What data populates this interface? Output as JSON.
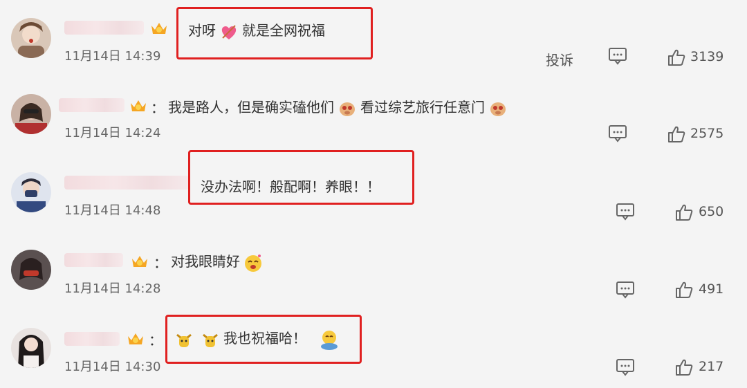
{
  "comments": [
    {
      "text": "对呀",
      "text2": "就是全网祝福",
      "time": "11月14日 14:39",
      "report": "投诉",
      "likes": "3139"
    },
    {
      "text": "我是路人，但是确实磕他们",
      "text2": "看过综艺旅行任意门",
      "time": "11月14日 14:24",
      "likes": "2575"
    },
    {
      "text": "没办法啊！般配啊！养眼！！",
      "time": "11月14日 14:48",
      "likes": "650"
    },
    {
      "text": "对我眼睛好",
      "time": "11月14日 14:28",
      "likes": "491"
    },
    {
      "text": "我也祝福哈！",
      "time": "11月14日 14:30",
      "likes": "217"
    }
  ],
  "colors": {
    "highlight": "#e02020",
    "background": "#f4f4f4"
  },
  "icons": [
    "vip-crown-icon",
    "heart-emoji-icon",
    "comment-icon",
    "thumbs-up-icon"
  ]
}
